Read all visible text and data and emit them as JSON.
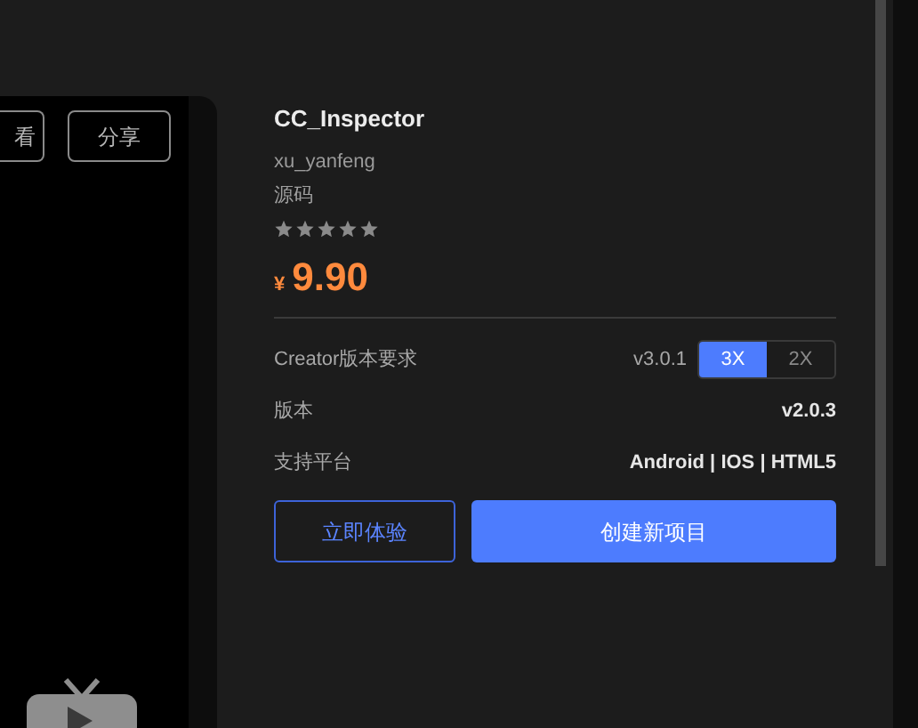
{
  "video": {
    "buttons": [
      "看",
      "分享"
    ]
  },
  "product": {
    "title": "CC_Inspector",
    "author": "xu_yanfeng",
    "type": "源码",
    "stars": 5,
    "currency": "¥",
    "price": "9.90"
  },
  "specs": [
    {
      "kind": "version-select",
      "label": "Creator版本要求",
      "value": "v3.0.1",
      "options": [
        {
          "label": "3X",
          "selected": true
        },
        {
          "label": "2X",
          "selected": false
        }
      ]
    },
    {
      "kind": "text",
      "label": "版本",
      "value": "v2.0.3"
    },
    {
      "kind": "text",
      "label": "支持平台",
      "value": "Android | IOS | HTML5"
    }
  ],
  "actions": [
    {
      "kind": "outline",
      "label": "立即体验"
    },
    {
      "kind": "primary",
      "label": "创建新项目"
    }
  ]
}
